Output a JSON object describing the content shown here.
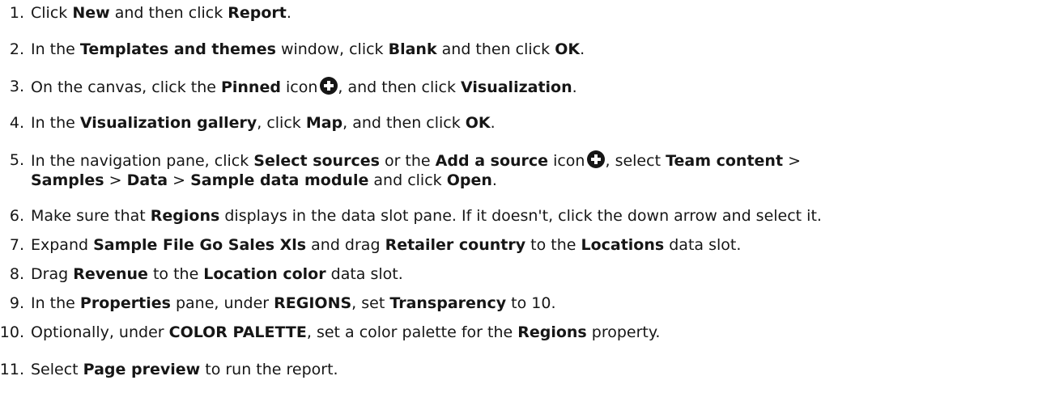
{
  "steps": [
    {
      "num": "1.",
      "parts": [
        {
          "t": "Click ",
          "b": false
        },
        {
          "t": "New",
          "b": true
        },
        {
          "t": " and then click ",
          "b": false
        },
        {
          "t": "Report",
          "b": true
        },
        {
          "t": ".",
          "b": false
        }
      ]
    },
    {
      "num": "2.",
      "parts": [
        {
          "t": "In the ",
          "b": false
        },
        {
          "t": "Templates and themes",
          "b": true
        },
        {
          "t": " window, click ",
          "b": false
        },
        {
          "t": "Blank",
          "b": true
        },
        {
          "t": " and then click ",
          "b": false
        },
        {
          "t": "OK",
          "b": true
        },
        {
          "t": ".",
          "b": false
        }
      ]
    },
    {
      "num": "3.",
      "parts": [
        {
          "t": "On the canvas, click the ",
          "b": false
        },
        {
          "t": "Pinned",
          "b": true
        },
        {
          "t": " icon",
          "b": false
        },
        {
          "icon": "plus-circle-icon"
        },
        {
          "t": ", and then click ",
          "b": false
        },
        {
          "t": "Visualization",
          "b": true
        },
        {
          "t": ".",
          "b": false
        }
      ]
    },
    {
      "num": "4.",
      "parts": [
        {
          "t": "In the ",
          "b": false
        },
        {
          "t": "Visualization gallery",
          "b": true
        },
        {
          "t": ", click ",
          "b": false
        },
        {
          "t": "Map",
          "b": true
        },
        {
          "t": ", and then click ",
          "b": false
        },
        {
          "t": "OK",
          "b": true
        },
        {
          "t": ".",
          "b": false
        }
      ]
    },
    {
      "num": "5.",
      "parts": [
        {
          "t": "In the navigation pane, click ",
          "b": false
        },
        {
          "t": "Select sources",
          "b": true
        },
        {
          "t": " or the ",
          "b": false
        },
        {
          "t": "Add a source",
          "b": true
        },
        {
          "t": " icon",
          "b": false
        },
        {
          "icon": "plus-circle-icon"
        },
        {
          "t": ", select ",
          "b": false
        },
        {
          "t": "Team content",
          "b": true
        },
        {
          "t": " >",
          "b": false
        }
      ],
      "parts2": [
        {
          "t": "Samples",
          "b": true
        },
        {
          "t": " > ",
          "b": false
        },
        {
          "t": "Data",
          "b": true
        },
        {
          "t": " > ",
          "b": false
        },
        {
          "t": "Sample data module",
          "b": true
        },
        {
          "t": " and click ",
          "b": false
        },
        {
          "t": "Open",
          "b": true
        },
        {
          "t": ".",
          "b": false
        }
      ]
    },
    {
      "num": "6.",
      "parts": [
        {
          "t": "Make sure that ",
          "b": false
        },
        {
          "t": "Regions",
          "b": true
        },
        {
          "t": " displays in the data slot pane. If it doesn't, click the down arrow and select it.",
          "b": false
        }
      ]
    },
    {
      "num": "7.",
      "parts": [
        {
          "t": "Expand ",
          "b": false
        },
        {
          "t": "Sample File Go Sales Xls",
          "b": true
        },
        {
          "t": " and drag ",
          "b": false
        },
        {
          "t": "Retailer country",
          "b": true
        },
        {
          "t": " to the ",
          "b": false
        },
        {
          "t": "Locations",
          "b": true
        },
        {
          "t": " data slot.",
          "b": false
        }
      ]
    },
    {
      "num": "8.",
      "parts": [
        {
          "t": "Drag ",
          "b": false
        },
        {
          "t": "Revenue",
          "b": true
        },
        {
          "t": " to the ",
          "b": false
        },
        {
          "t": "Location color",
          "b": true
        },
        {
          "t": " data slot.",
          "b": false
        }
      ]
    },
    {
      "num": "9.",
      "parts": [
        {
          "t": "In the ",
          "b": false
        },
        {
          "t": "Properties",
          "b": true
        },
        {
          "t": " pane, under ",
          "b": false
        },
        {
          "t": "REGIONS",
          "b": true
        },
        {
          "t": ", set ",
          "b": false
        },
        {
          "t": "Transparency",
          "b": true
        },
        {
          "t": " to 10.",
          "b": false
        }
      ]
    },
    {
      "num": "10.",
      "parts": [
        {
          "t": "Optionally, under ",
          "b": false
        },
        {
          "t": "COLOR PALETTE",
          "b": true
        },
        {
          "t": ", set a color palette for the ",
          "b": false
        },
        {
          "t": "Regions",
          "b": true
        },
        {
          "t": " property.",
          "b": false
        }
      ]
    },
    {
      "num": "11.",
      "parts": [
        {
          "t": "Select ",
          "b": false
        },
        {
          "t": "Page preview",
          "b": true
        },
        {
          "t": " to run the report.",
          "b": false
        }
      ]
    }
  ]
}
